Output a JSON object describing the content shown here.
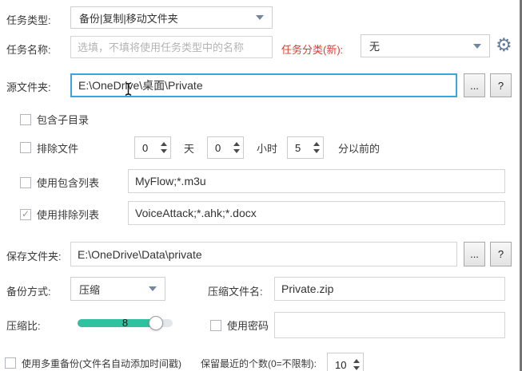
{
  "icons": {
    "check": "✓",
    "gear": "⚙"
  },
  "colors": {
    "focus_border": "#38a6de",
    "red_label": "#e23a2e",
    "slider_green": "#2fc2a0",
    "combo_arrow": "#7086a3",
    "gear": "#607d9b"
  },
  "task_type": {
    "label": "任务类型:",
    "value": "备份|复制|移动文件夹"
  },
  "task_name": {
    "label": "任务名称:",
    "placeholder": "选填，不填将使用任务类型中的名称",
    "value": ""
  },
  "task_category": {
    "label": "任务分类(新):",
    "value": "无"
  },
  "source_folder": {
    "label": "源文件夹:",
    "value": "E:\\OneDrive\\桌面\\Private",
    "browse_label": "...",
    "help_label": "?"
  },
  "include_subdirs": {
    "label": "包含子目录",
    "checked": false
  },
  "exclude_files": {
    "label": "排除文件",
    "checked": false,
    "days": {
      "value": "0",
      "unit": "天"
    },
    "hours": {
      "value": "0",
      "unit": "小时"
    },
    "minutes": {
      "value": "5",
      "unit": "分以前的"
    }
  },
  "include_list": {
    "label": "使用包含列表",
    "checked": false,
    "value": "MyFlow;*.m3u"
  },
  "exclude_list": {
    "label": "使用排除列表",
    "checked": true,
    "value": "VoiceAttack;*.ahk;*.docx"
  },
  "save_folder": {
    "label": "保存文件夹:",
    "value": "E:\\OneDrive\\Data\\private",
    "browse_label": "...",
    "help_label": "?"
  },
  "backup_method": {
    "label": "备份方式:",
    "value": "压缩"
  },
  "zip_name": {
    "label": "压缩文件名:",
    "value": "Private.zip"
  },
  "compression": {
    "label": "压缩比:",
    "value": "8"
  },
  "password": {
    "label": "使用密码",
    "checked": false,
    "value": ""
  },
  "multi_backup": {
    "label": "使用多重备份(文件名自动添加时间戳)",
    "checked": false
  },
  "keep_count": {
    "label": "保留最近的个数(0=不限制):",
    "value": "10"
  }
}
